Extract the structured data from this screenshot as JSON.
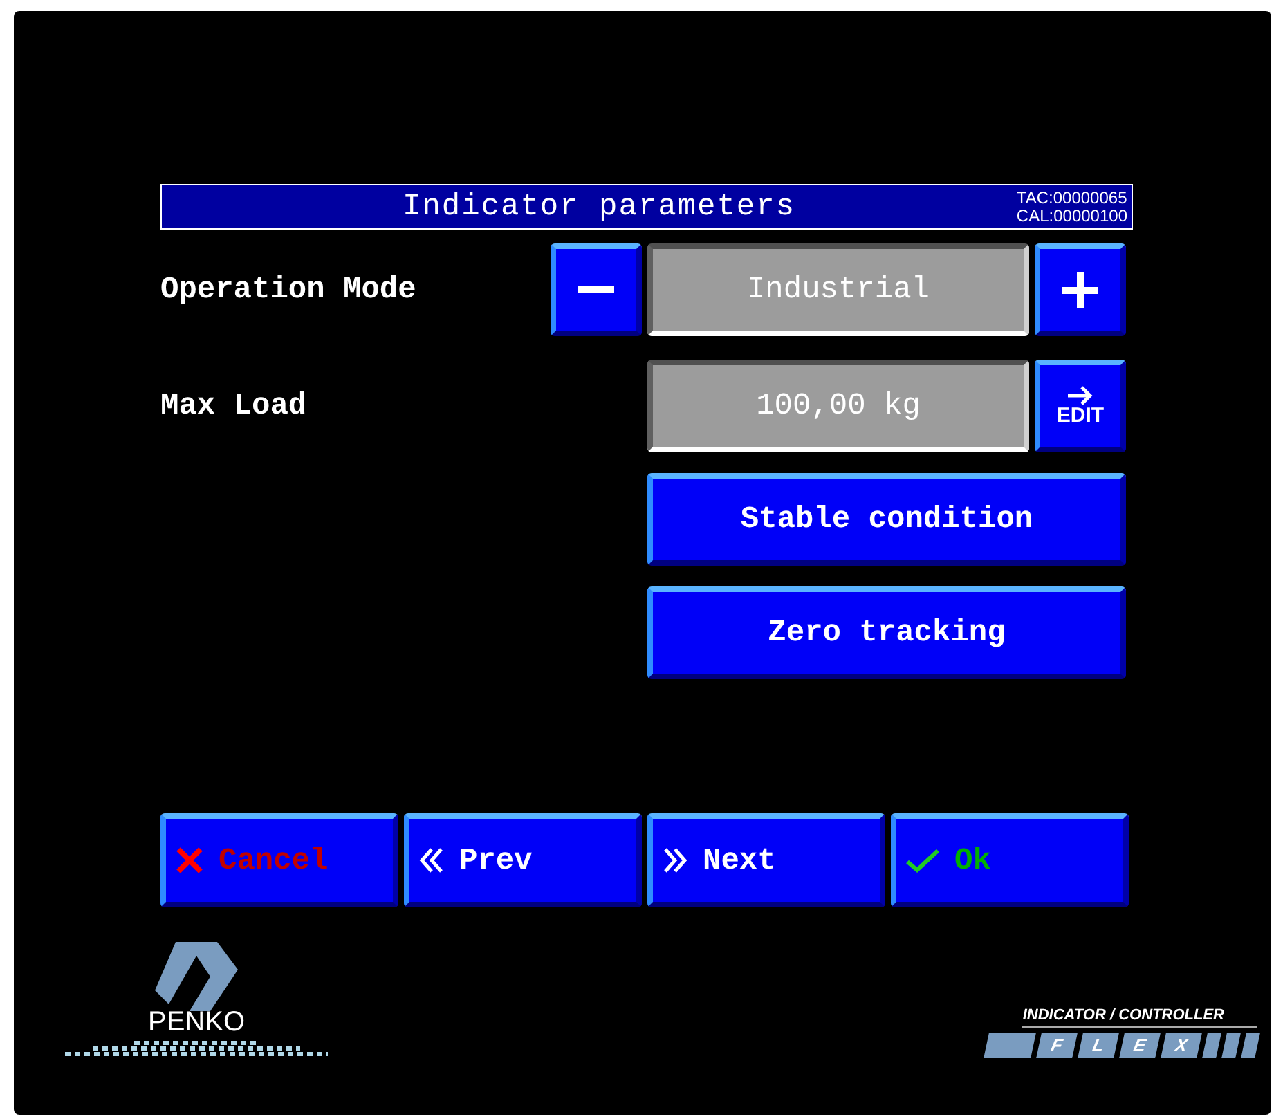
{
  "title_bar": {
    "title": "Indicator parameters",
    "tac": "TAC:00000065",
    "cal": "CAL:00000100"
  },
  "operation_mode": {
    "label": "Operation Mode",
    "value": "Industrial"
  },
  "max_load": {
    "label": "Max Load",
    "value": "100,00 kg",
    "edit_label": "EDIT"
  },
  "option_buttons": [
    "Stable condition",
    "Zero tracking"
  ],
  "nav_buttons": [
    {
      "kind": "cancel",
      "label": "Cancel"
    },
    {
      "kind": "prev",
      "label": "Prev"
    },
    {
      "kind": "next",
      "label": "Next"
    },
    {
      "kind": "ok",
      "label": "Ok"
    }
  ],
  "logo": {
    "text": "PENKO"
  },
  "product": {
    "caption": "INDICATOR / CONTROLLER",
    "letters": [
      "F",
      "L",
      "E",
      "X"
    ]
  }
}
